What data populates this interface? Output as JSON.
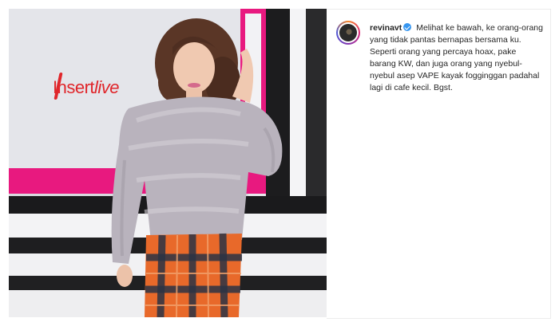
{
  "post": {
    "username": "revinavt",
    "verified": true,
    "caption": "Melihat ke bawah, ke orang-orang yang tidak pantas bernapas bersama ku. Seperti orang yang percaya hoax, pake barang KW, dan juga orang yang nyebul-nyebul asep VAPE kayak fogginggan padahal lagi di cafe kecil. Bgst."
  },
  "photo": {
    "backdrop_logo": {
      "part1": "Insert",
      "part2": "live"
    }
  },
  "colors": {
    "verified_badge": "#3897f0",
    "logo_red": "#e0262b",
    "magenta_frame": "#e8197f",
    "skirt_orange": "#e8692a",
    "sweater_lilac": "#b9b3bd"
  }
}
